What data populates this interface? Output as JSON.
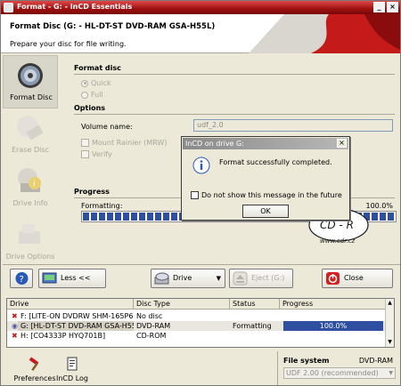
{
  "window": {
    "title": "Format - G: - InCD Essentials"
  },
  "header": {
    "title": "Format Disc (G: - HL-DT-ST DVD-RAM GSA-H55L)",
    "subtitle": "Prepare your disc for file writing."
  },
  "sidebar": {
    "items": [
      {
        "label": "Format Disc",
        "icon": "disc-icon",
        "enabled": true
      },
      {
        "label": "Erase Disc",
        "icon": "eraser-icon",
        "enabled": false
      },
      {
        "label": "Drive Info",
        "icon": "info-icon",
        "enabled": false
      },
      {
        "label": "Drive Options",
        "icon": "options-icon",
        "enabled": false
      }
    ]
  },
  "format": {
    "section_title": "Format disc",
    "quick_label": "Quick",
    "full_label": "Full",
    "selected": "Quick"
  },
  "options": {
    "section_title": "Options",
    "volume_label": "Volume name:",
    "volume_value": "udf_2.0",
    "mount_rainier_label": "Mount Rainier (MRW)",
    "verify_label": "Verify"
  },
  "progress": {
    "section_title": "Progress",
    "status_label": "Formatting:",
    "percent_text": "100.0%",
    "fraction": 1.0
  },
  "buttons": {
    "help_icon": "help-icon",
    "less_label": "Less <<",
    "drive_label": "Drive",
    "eject_label": "Eject (G:)",
    "close_label": "Close"
  },
  "drive_table": {
    "headers": [
      "Drive",
      "Disc Type",
      "Status",
      "Progress"
    ],
    "rows": [
      {
        "drive": "F: [LITE-ON DVDRW SHM-165P6S]",
        "disc": "No disc",
        "status": "",
        "progress": "",
        "icon": "error-icon"
      },
      {
        "drive": "G: [HL-DT-ST DVD-RAM GSA-H55L]",
        "disc": "DVD-RAM",
        "status": "Formatting",
        "progress": "100.0%",
        "icon": "disc-icon"
      },
      {
        "drive": "H: [CO4333P HYQ701B]",
        "disc": "CD-ROM",
        "status": "",
        "progress": "",
        "icon": "error-icon"
      }
    ]
  },
  "statusbar": {
    "preferences_label": "Preferences",
    "log_label": "InCD Log",
    "fs_title": "File system",
    "fs_type": "DVD-RAM",
    "fs_value": "UDF 2.00 (recommended)"
  },
  "dialog": {
    "title": "InCD on drive G:",
    "message": "Format successfully completed.",
    "checkbox_label": "Do not show this message in the future",
    "ok_label": "OK"
  },
  "stamp": {
    "text": "CD - R",
    "url": "www.cdr.cz"
  },
  "colors": {
    "title_red": "#c41a1a",
    "progress_blue": "#2f4fa0",
    "accent_red": "#d42020"
  }
}
